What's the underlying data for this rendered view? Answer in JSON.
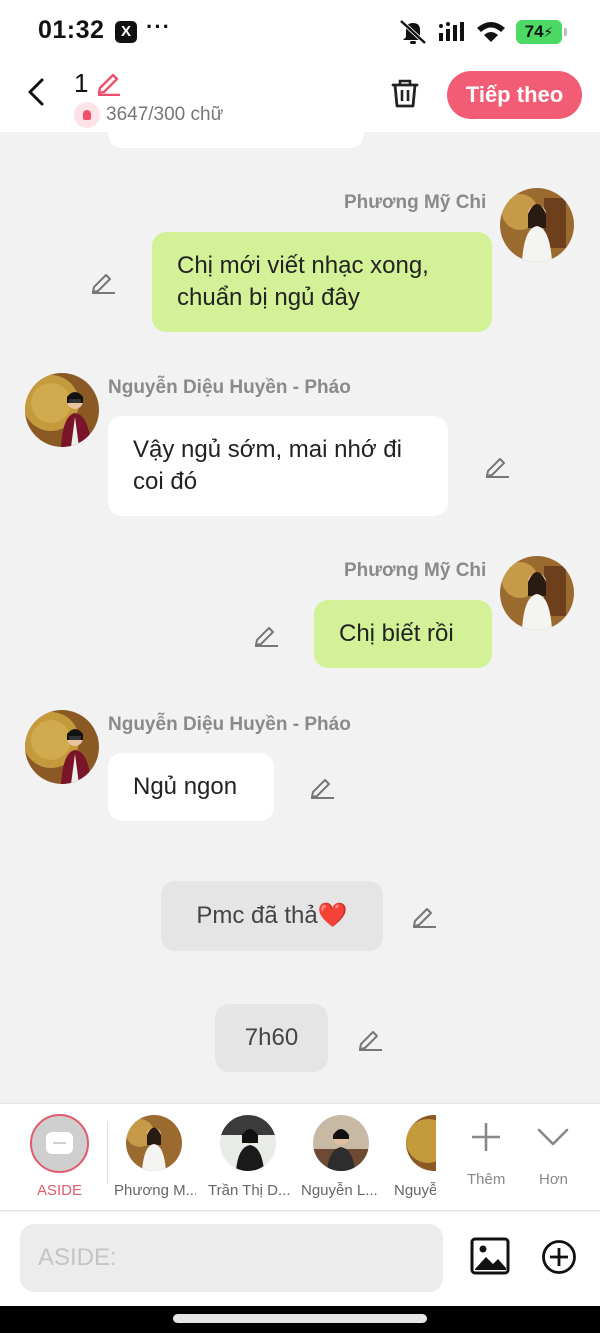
{
  "status_bar": {
    "time": "01:32",
    "x_icon": "X",
    "dots": "···",
    "battery": "74"
  },
  "header": {
    "chapter_number": "1",
    "word_count": "3647/300 chữ",
    "next_button": "Tiếp theo"
  },
  "messages": [
    {
      "sender": "Phương Mỹ Chi",
      "side": "right",
      "text": "Chị mới viết nhạc xong, chuẩn bị ngủ đây"
    },
    {
      "sender": "Nguyễn Diệu Huyền - Pháo",
      "side": "left",
      "text": "Vậy ngủ sớm, mai nhớ đi coi đó"
    },
    {
      "sender": "Phương Mỹ Chi",
      "side": "right",
      "text": "Chị biết rồi"
    },
    {
      "sender": "Nguyễn Diệu Huyền - Pháo",
      "side": "left",
      "text": "Ngủ ngon"
    },
    {
      "side": "aside",
      "text": "Pmc đã thả❤️"
    },
    {
      "side": "aside",
      "text": "7h60"
    }
  ],
  "character_bar": {
    "aside_label": "ASIDE",
    "characters": [
      {
        "label": "Phương M..."
      },
      {
        "label": "Trần Thị D..."
      },
      {
        "label": "Nguyễn L..."
      },
      {
        "label": "Nguyễ"
      }
    ],
    "add_label": "Thêm",
    "more_label": "Hơn"
  },
  "input": {
    "placeholder": "ASIDE:"
  },
  "colors": {
    "accent": "#f25c74",
    "my_bubble": "#d3f197",
    "their_bubble": "#ffffff",
    "aside_bubble": "#e5e5e5"
  }
}
